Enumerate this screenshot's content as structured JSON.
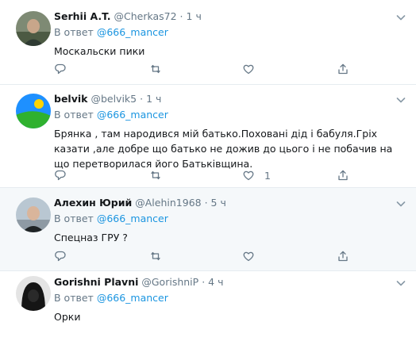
{
  "tweets": [
    {
      "name": "Serhii A.T.",
      "handle": "@Cherkas72",
      "dot": "·",
      "time": "1 ч",
      "reply_prefix": "В ответ",
      "reply_mention": "@666_mancer",
      "text": "Москальски пики",
      "like_count": ""
    },
    {
      "name": "belvik",
      "handle": "@belvik5",
      "dot": "·",
      "time": "1 ч",
      "reply_prefix": "В ответ",
      "reply_mention": "@666_mancer",
      "text": "Брянка , там народився мій батько.Поховані дід і бабуля.Гріх казати ,але добре що батько не дожив до цього  і не побачив на що перетворилася його Батьківщина.",
      "like_count": "1"
    },
    {
      "name": "Алехин Юрий",
      "handle": "@Alehin1968",
      "dot": "·",
      "time": "5 ч",
      "reply_prefix": "В ответ",
      "reply_mention": "@666_mancer",
      "text": "Спецназ ГРУ ?",
      "like_count": ""
    },
    {
      "name": "Gorishni Plavni",
      "handle": "@GorishniP",
      "dot": "·",
      "time": "4 ч",
      "reply_prefix": "В ответ",
      "reply_mention": "@666_mancer",
      "text": "Орки",
      "like_count": ""
    }
  ],
  "colors": {
    "accent": "#1b95e0",
    "secondary_text": "#657786",
    "highlight_bg": "#f5f8fa"
  },
  "icons": [
    "reply-icon",
    "retweet-icon",
    "like-icon",
    "share-icon",
    "chevron-down-icon"
  ]
}
